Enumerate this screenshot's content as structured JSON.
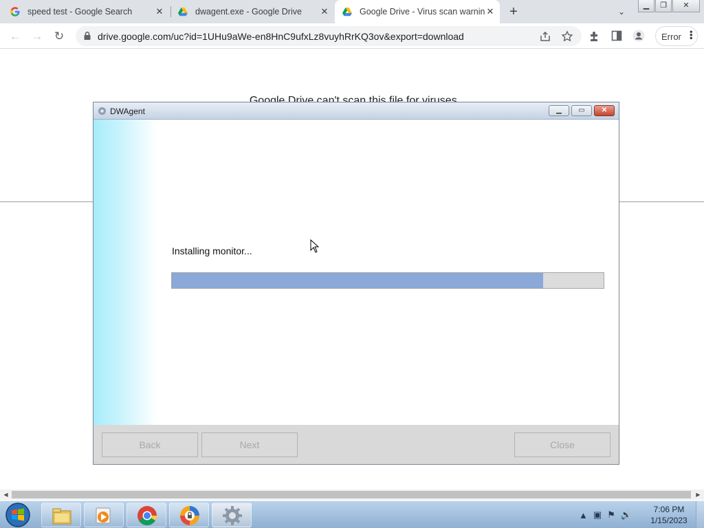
{
  "browser": {
    "tabs": [
      {
        "title": "speed test - Google Search",
        "icon": "google-icon"
      },
      {
        "title": "dwagent.exe - Google Drive",
        "icon": "google-drive-icon"
      },
      {
        "title": "Google Drive - Virus scan warning",
        "icon": "google-drive-icon"
      }
    ],
    "active_tab_index": 2,
    "new_tab_label": "+",
    "url": "drive.google.com/uc?id=1UHu9aWe-en8HnC9ufxLz8vuyhRrKQ3ov&export=download",
    "profile_error_label": "Error"
  },
  "page": {
    "heading": "Google Drive can't scan this file for viruses."
  },
  "dialog": {
    "title": "DWAgent",
    "status": "Installing monitor...",
    "progress_fraction": 0.86,
    "buttons": {
      "back": "Back",
      "next": "Next",
      "close": "Close"
    }
  },
  "taskbar": {
    "apps": [
      "windows-explorer",
      "media-player",
      "google-chrome",
      "dwagent-installer-lock",
      "dwagent-gear"
    ],
    "clock": {
      "time": "7:06 PM",
      "date": "1/15/2023"
    }
  },
  "colors": {
    "progress_fill": "#8aa9d8",
    "dialog_side_gradient": "#a8ecfb",
    "tab_strip": "#dee1e6"
  }
}
